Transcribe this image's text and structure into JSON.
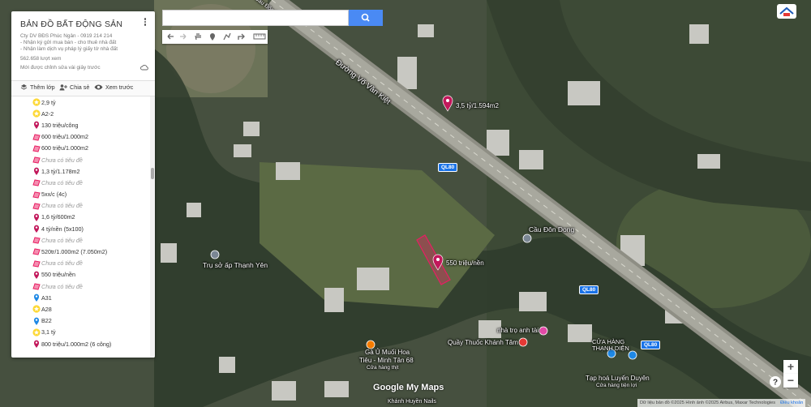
{
  "panel": {
    "title": "BẢN ĐỒ BẤT ĐỘNG SẢN",
    "description": [
      "Cty DV BĐS Phúc Ngân - 0919 214 214",
      "- Nhận ký gửi mua bán - cho thuê nhà đất",
      "- Nhận làm dịch vụ pháp lý giấy tờ nhà đất"
    ],
    "views": "562.658 lượt xem",
    "edited": "Mới được chỉnh sửa vài giây trước",
    "add_layer": "Thêm lớp",
    "share": "Chia sẻ",
    "preview": "Xem trước"
  },
  "items": [
    {
      "label": "2,9 tỷ",
      "icon": "star-yellow",
      "empty": false
    },
    {
      "label": "A2-2",
      "icon": "star-yellow",
      "empty": false
    },
    {
      "label": "130 triệu/công",
      "icon": "pin-red",
      "empty": false
    },
    {
      "label": "600 triệu/1.000m2",
      "icon": "polygon-pink",
      "empty": false
    },
    {
      "label": "600 triệu/1.000m2",
      "icon": "polygon-pink",
      "empty": false
    },
    {
      "label": "Chưa có tiêu đề",
      "icon": "polygon-pink",
      "empty": true
    },
    {
      "label": "1,3 tỷ/1.178m2",
      "icon": "pin-red",
      "empty": false
    },
    {
      "label": "Chưa có tiêu đề",
      "icon": "polygon-pink",
      "empty": true
    },
    {
      "label": "5xx/c (4c)",
      "icon": "polygon-pink",
      "empty": false
    },
    {
      "label": "Chưa có tiêu đề",
      "icon": "polygon-pink",
      "empty": true
    },
    {
      "label": "1,6 tỷ/600m2",
      "icon": "pin-red",
      "empty": false
    },
    {
      "label": "4 tỷ/nền (5x100)",
      "icon": "pin-red",
      "empty": false
    },
    {
      "label": "Chưa có tiêu đề",
      "icon": "polygon-pink",
      "empty": true
    },
    {
      "label": "520tr/1.000m2 (7.050m2)",
      "icon": "polygon-pink",
      "empty": false
    },
    {
      "label": "Chưa có tiêu đề",
      "icon": "polygon-pink",
      "empty": true
    },
    {
      "label": "550 triệu/nền",
      "icon": "pin-red",
      "empty": false
    },
    {
      "label": "Chưa có tiêu đề",
      "icon": "polygon-pink",
      "empty": true
    },
    {
      "label": "A31",
      "icon": "pin-blue",
      "empty": false
    },
    {
      "label": "A28",
      "icon": "star-yellow",
      "empty": false
    },
    {
      "label": "B22",
      "icon": "pin-blue",
      "empty": false
    },
    {
      "label": "3,1 tỷ",
      "icon": "star-yellow",
      "empty": false
    },
    {
      "label": "800 triệu/1.000m2 (6 công)",
      "icon": "pin-red",
      "empty": false
    }
  ],
  "map": {
    "labels": {
      "road_name": "Đường Võ Văn Kiệt",
      "road_top": "Cầu Đôn Dong",
      "bridge": "Cầu Đôn Dong",
      "pin1": "3,5 tỷ/1.594m2",
      "pin2": "550 triệu/nền",
      "office": "Trụ sở ấp Thạnh Yên",
      "inn": "nhà trọ anh tài",
      "pharmacy": "Quầy Thuốc Khánh Tâm",
      "store": "CỬA HÀNG THẠNH DIỆN",
      "chicken1": "Gà Ủ Muối Hoa",
      "chicken2": "Tiêu - Minh Tân 68",
      "chicken3": "Cửa hàng thịt",
      "grocery1": "Tạp hoá Luyến Duyên",
      "grocery2": "Cửa hàng tiện lợi",
      "nails": "Khánh Huyền Nails",
      "ql80_a": "QL80",
      "ql80_b": "QL80",
      "ql80_c": "QL80"
    },
    "logo": "Google My Maps",
    "attribution": "Dữ liệu bản đồ ©2025 Hình ảnh ©2025 Airbus, Maxar Technologies",
    "terms": "Điều khoản",
    "zoom_in": "+",
    "zoom_out": "−"
  },
  "search": {
    "placeholder": ""
  },
  "colors": {
    "accent": "#4a8af4",
    "pin_red": "#c2185b",
    "polygon_pink": "#e91e63",
    "star_yellow": "#fdd835",
    "pin_blue": "#1e88e5"
  }
}
